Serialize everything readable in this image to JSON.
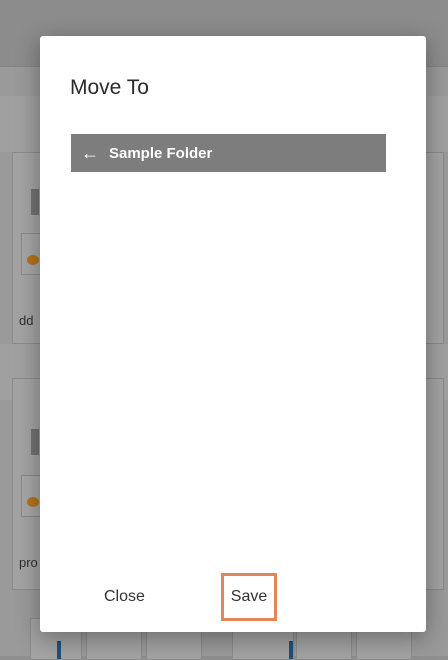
{
  "background": {
    "cards": [
      {
        "label": "dd"
      },
      {
        "label": "pro"
      }
    ]
  },
  "modal": {
    "title": "Move To",
    "breadcrumb": {
      "icon": "back-arrow-icon",
      "label": "Sample Folder"
    },
    "actions": {
      "close_label": "Close",
      "save_label": "Save"
    }
  },
  "colors": {
    "breadcrumb_bg": "#7d7d7d",
    "save_highlight": "#e0875a",
    "accent_orange": "#b3731a",
    "overlay": "#9a9a9a"
  }
}
